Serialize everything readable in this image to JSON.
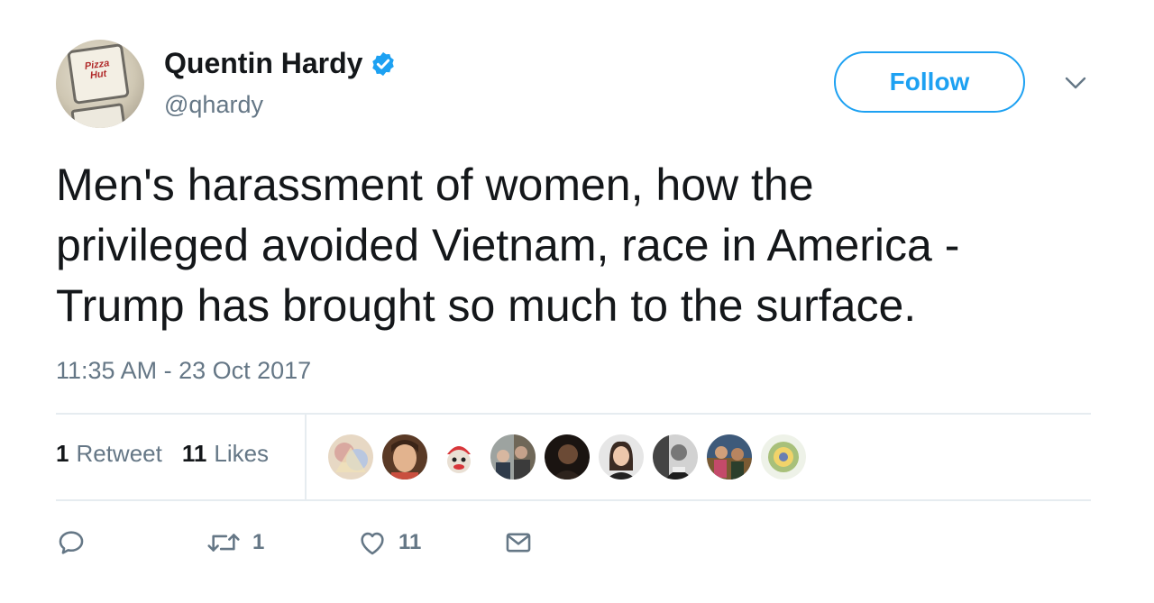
{
  "user": {
    "name": "Quentin Hardy",
    "handle": "@qhardy",
    "verified": true,
    "avatar_sign_text": "Pizza Hut"
  },
  "follow_label": "Follow",
  "tweet": {
    "lines": [
      "Men's harassment of women, how the",
      "privileged avoided Vietnam, race in America -",
      "Trump has brought so much to the surface."
    ],
    "timestamp": "11:35 AM - 23 Oct 2017"
  },
  "stats": {
    "retweets_count": "1",
    "retweets_label": "Retweet",
    "likes_count": "11",
    "likes_label": "Likes"
  },
  "likers": [
    {
      "name": "liker-1"
    },
    {
      "name": "liker-2"
    },
    {
      "name": "liker-3"
    },
    {
      "name": "liker-4"
    },
    {
      "name": "liker-5"
    },
    {
      "name": "liker-6"
    },
    {
      "name": "liker-7"
    },
    {
      "name": "liker-8"
    },
    {
      "name": "liker-9"
    }
  ],
  "actions": {
    "reply_icon": "reply-icon",
    "retweet_icon": "retweet-icon",
    "retweet_count": "1",
    "like_icon": "heart-icon",
    "like_count": "11",
    "dm_icon": "envelope-icon"
  },
  "colors": {
    "accent": "#1da1f2",
    "secondary_text": "#657786",
    "primary_text": "#14171a",
    "divider": "#e6ecf0"
  }
}
